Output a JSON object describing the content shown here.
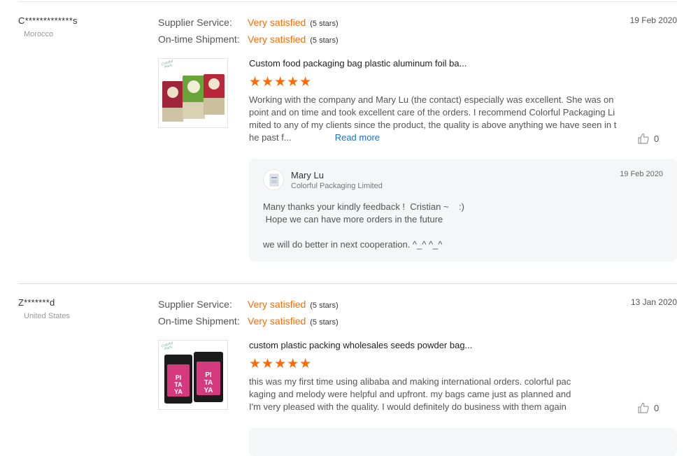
{
  "reviews": [
    {
      "buyer": "C*************s",
      "country": "Morocco",
      "date": "19 Feb 2020",
      "supplier_service_label": "Supplier Service:",
      "supplier_service_value": "Very satisfied",
      "supplier_service_stars": "(5 stars)",
      "shipment_label": "On-time Shipment:",
      "shipment_value": "Very satisfied",
      "shipment_stars": "(5 stars)",
      "product_title": "Custom food packaging bag plastic aluminum foil ba...",
      "rating": 5,
      "stars_text": "★★★★★",
      "text_lines": [
        "Working with the company and Mary Lu (the contact) especially was excellent. She was on",
        "point and on time and took excellent care of the orders. I recommend Colorful Packaging Li",
        "mited to any of my clients since the product, the quality is above anything we have seen in t",
        "he past f..."
      ],
      "read_more": "Read more",
      "likes": "0",
      "reply": {
        "name": "Mary Lu",
        "company": "Colorful Packaging Limited",
        "date": "19 Feb 2020",
        "lines": [
          "Many thanks your kindly feedback !  Cristian ~    :)",
          " Hope we can have more orders in the future",
          "",
          "we will do better in next cooperation. ^_^ ^_^"
        ]
      }
    },
    {
      "buyer": "Z*******d",
      "country": "United States",
      "date": "13 Jan 2020",
      "supplier_service_label": "Supplier Service:",
      "supplier_service_value": "Very satisfied",
      "supplier_service_stars": "(5 stars)",
      "shipment_label": "On-time Shipment:",
      "shipment_value": "Very satisfied",
      "shipment_stars": "(5 stars)",
      "product_title": "custom plastic packing wholesales seeds powder bag...",
      "rating": 5,
      "stars_text": "★★★★★",
      "text_lines": [
        "this was my first time using alibaba and making international orders. colorful pac",
        "kaging and melody were helpful and upfront. my bags came just as planned and",
        "I'm very pleased with the quality. I would definitely do business with them again"
      ],
      "likes": "0"
    }
  ],
  "thumbnail_brand": "Colorful Pack",
  "product_image_text": "PITAYA",
  "colors": {
    "accent": "#ff6a00",
    "link": "#1a70c7"
  }
}
